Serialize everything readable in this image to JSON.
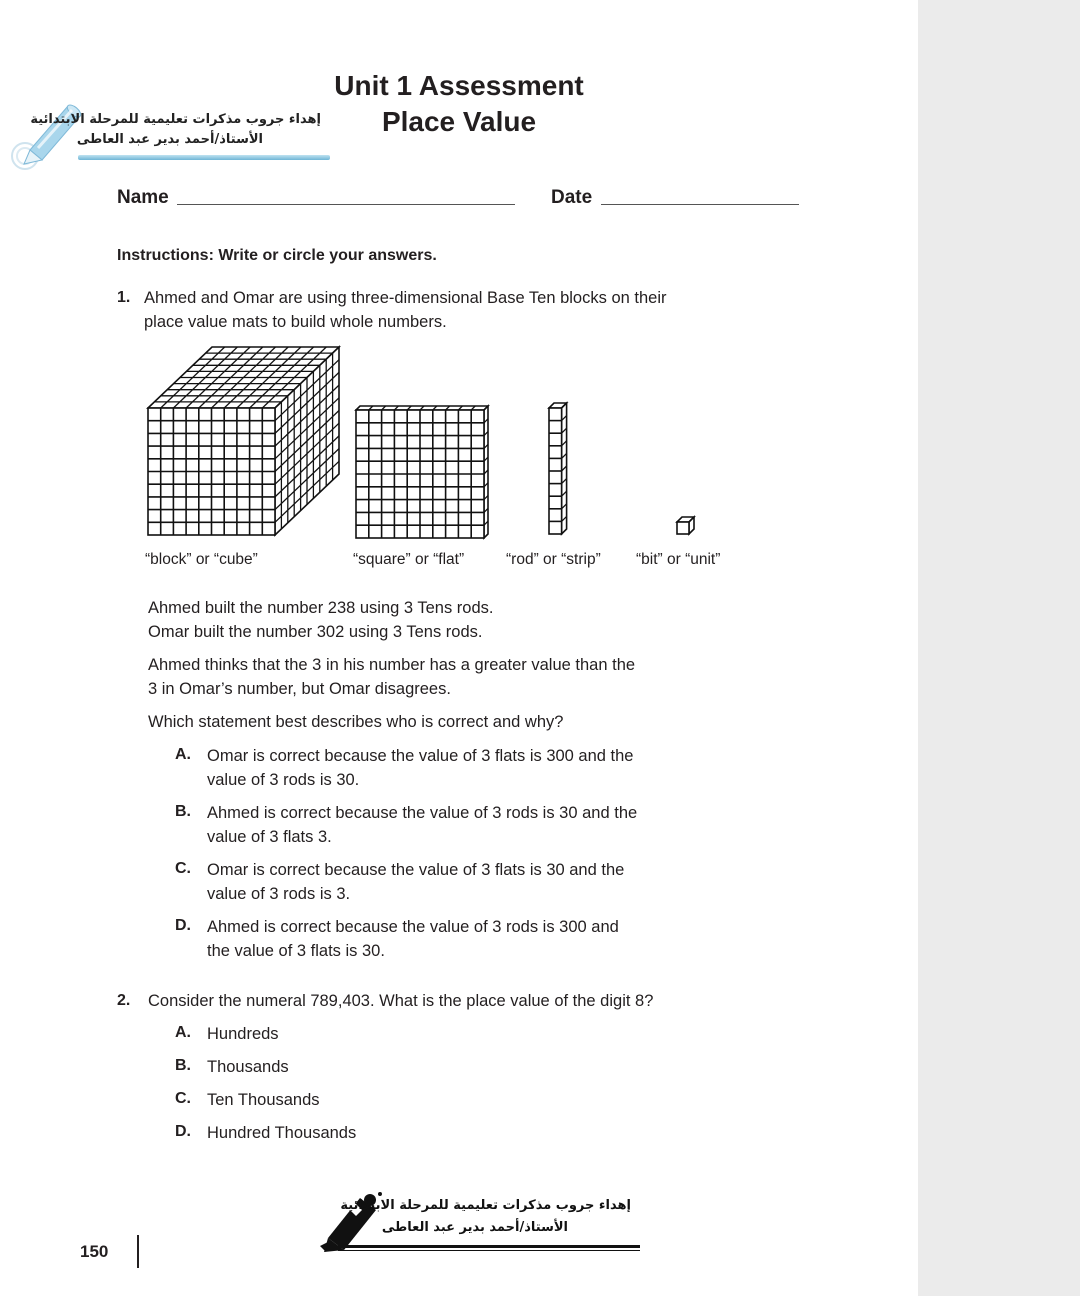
{
  "header": {
    "title_line1": "Unit 1 Assessment",
    "title_line2": "Place Value",
    "logo_top": {
      "line1": "إهداء جروب مذكرات تعليمية للمرحلة الابتدائية",
      "line2": "الأستاذ/أحمد بدير عبد العاطى",
      "icon": "pencil-icon"
    }
  },
  "form": {
    "name_label": "Name",
    "date_label": "Date",
    "name_value": "",
    "date_value": ""
  },
  "instructions": "Instructions: Write or circle your answers.",
  "question1": {
    "number": "1.",
    "intro_line1": "Ahmed and Omar are using three-dimensional Base Ten blocks on their",
    "intro_line2": "place value mats to build whole numbers.",
    "figure_captions": {
      "cube": "“block” or “cube”",
      "flat": "“square” or “flat”",
      "rod": "“rod” or “strip”",
      "unit": "“bit” or “unit”"
    },
    "para1_line1": "Ahmed built the number 238 using 3 Tens rods.",
    "para1_line2": "Omar built the number 302 using 3 Tens rods.",
    "para2_line1": "Ahmed thinks that the 3 in his number has a greater value than the",
    "para2_line2": "3 in Omar’s number, but Omar disagrees.",
    "prompt": "Which statement best describes who is correct and why?",
    "options": [
      {
        "letter": "A.",
        "line1": "Omar is correct because the value of 3 flats is 300 and the",
        "line2": "value of 3 rods is 30."
      },
      {
        "letter": "B.",
        "line1": "Ahmed is correct because the value of 3 rods is 30 and the",
        "line2": "value of 3 flats 3."
      },
      {
        "letter": "C.",
        "line1": "Omar is correct because the value of 3 flats is 30 and the",
        "line2": "value of 3 rods is 3."
      },
      {
        "letter": "D.",
        "line1": "Ahmed is correct because the value of 3 rods is 300 and",
        "line2": "the value of 3 flats is 30."
      }
    ]
  },
  "question2": {
    "number": "2.",
    "text": "Consider the numeral 789,403. What is the place value of the digit 8?",
    "options": [
      {
        "letter": "A.",
        "text": "Hundreds"
      },
      {
        "letter": "B.",
        "text": "Thousands"
      },
      {
        "letter": "C.",
        "text": "Ten Thousands"
      },
      {
        "letter": "D.",
        "text": "Hundred Thousands"
      }
    ]
  },
  "footer": {
    "page_number": "150",
    "logo_bottom": {
      "line1": "إهداء جروب مذكرات تعليمية للمرحلة الابتدائية",
      "line2": "الأستاذ/أحمد بدير عبد العاطى",
      "icon": "pencil-icon"
    }
  },
  "colors": {
    "text": "#231f20",
    "side_panel": "#ebebeb",
    "logo_bar": "#6fb5d6"
  }
}
